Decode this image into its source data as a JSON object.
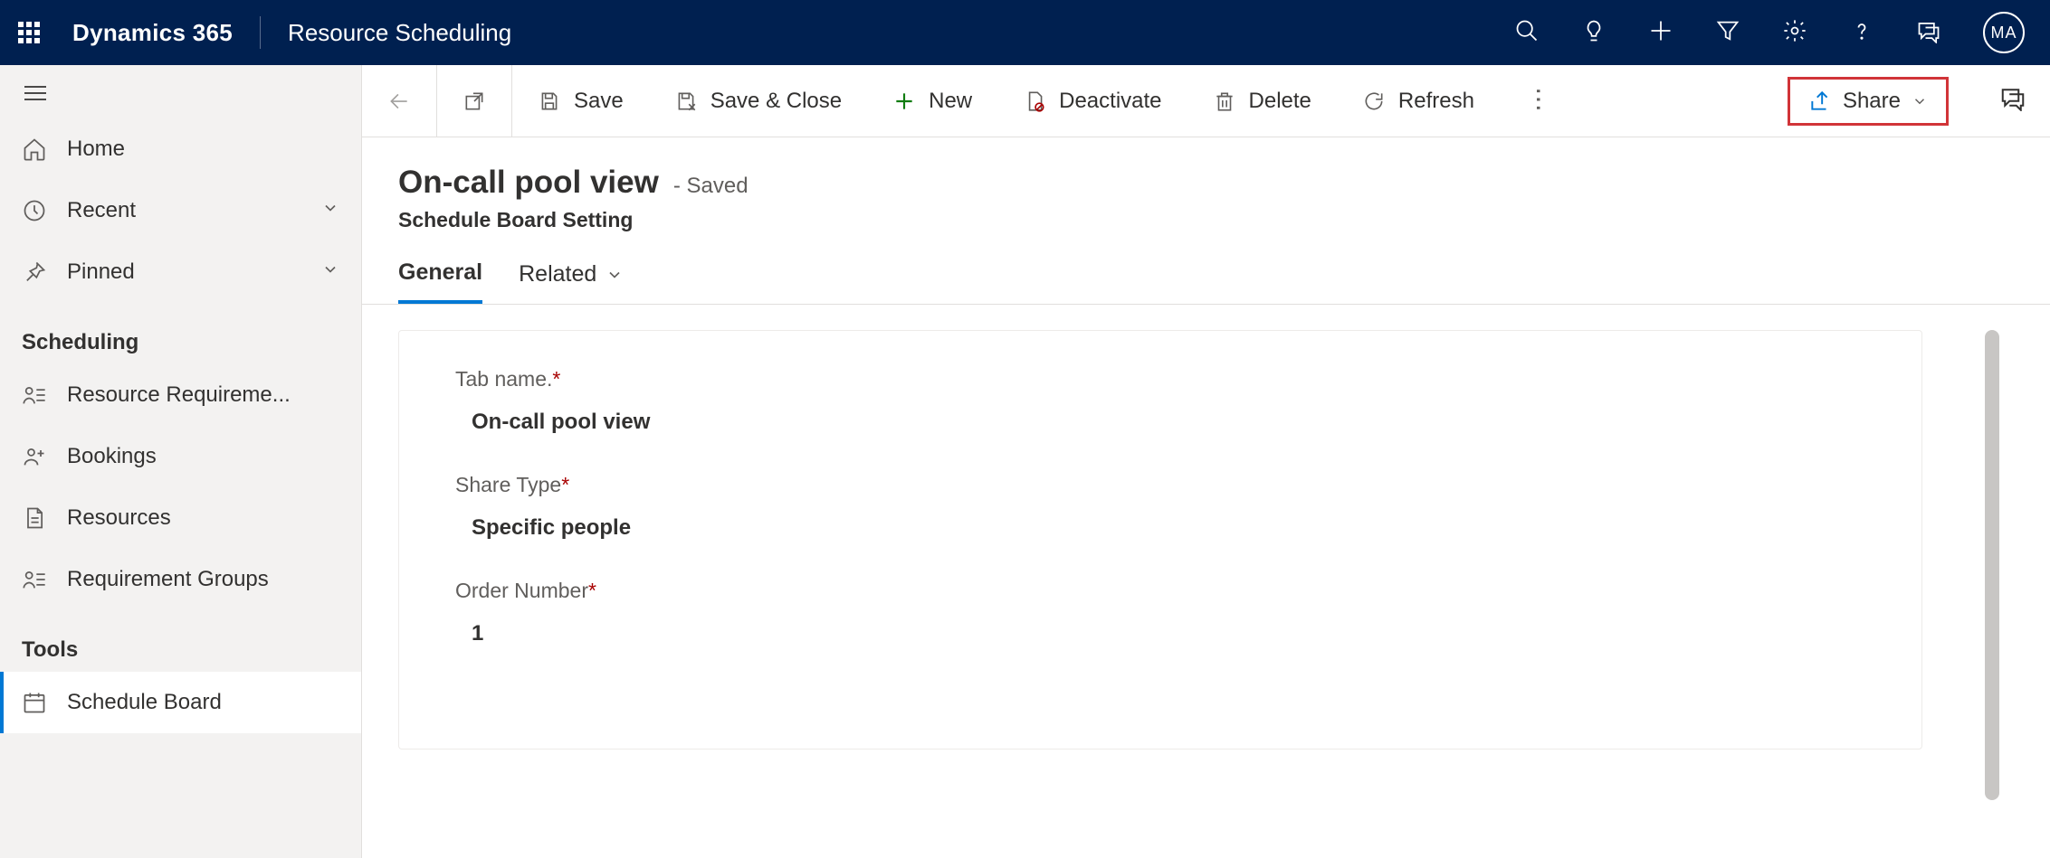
{
  "header": {
    "brand": "Dynamics 365",
    "module": "Resource Scheduling",
    "avatar_initials": "MA"
  },
  "sidebar": {
    "items_top": [
      {
        "icon": "home",
        "label": "Home"
      },
      {
        "icon": "clock",
        "label": "Recent",
        "chevron": true
      },
      {
        "icon": "pin",
        "label": "Pinned",
        "chevron": true
      }
    ],
    "section_scheduling": "Scheduling",
    "items_scheduling": [
      {
        "icon": "person-list",
        "label": "Resource Requireme..."
      },
      {
        "icon": "person-plus",
        "label": "Bookings"
      },
      {
        "icon": "doc",
        "label": "Resources"
      },
      {
        "icon": "person-list",
        "label": "Requirement Groups"
      }
    ],
    "section_tools": "Tools",
    "items_tools": [
      {
        "icon": "calendar",
        "label": "Schedule Board",
        "active": true
      }
    ]
  },
  "commands": {
    "save": "Save",
    "save_close": "Save & Close",
    "new": "New",
    "deactivate": "Deactivate",
    "delete": "Delete",
    "refresh": "Refresh",
    "share": "Share"
  },
  "page": {
    "title": "On-call pool view",
    "saved": "- Saved",
    "entity": "Schedule Board Setting"
  },
  "tabs": {
    "general": "General",
    "related": "Related"
  },
  "form": {
    "tab_name_label": "Tab name.",
    "tab_name_value": "On-call pool view",
    "share_type_label": "Share Type",
    "share_type_value": "Specific people",
    "order_number_label": "Order Number",
    "order_number_value": "1"
  }
}
